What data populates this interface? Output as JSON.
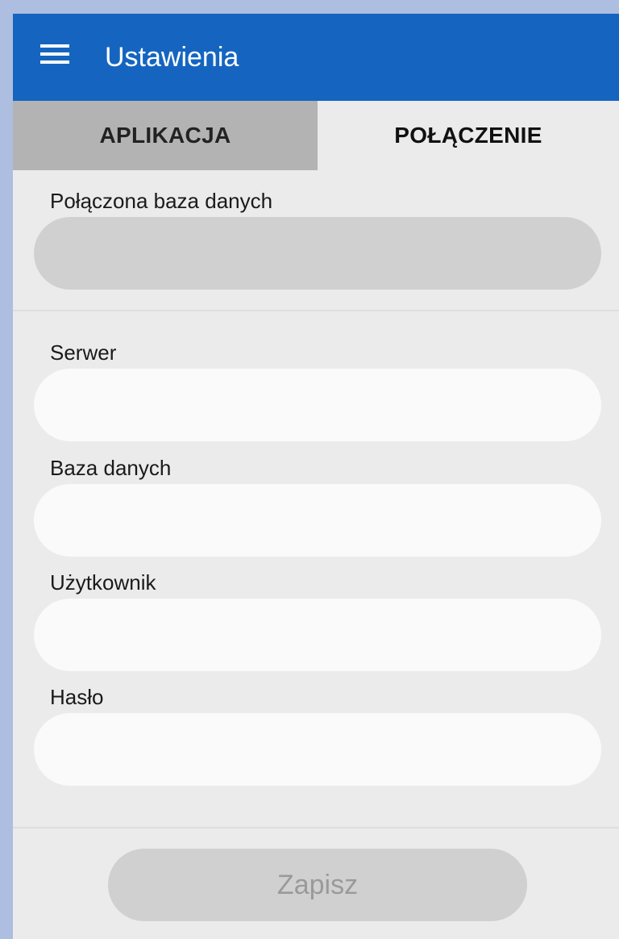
{
  "appbar": {
    "title": "Ustawienia",
    "menu_icon": "hamburger-menu-icon",
    "color": "#1565c0"
  },
  "tabs": [
    {
      "label": "APLIKACJA",
      "selected": false
    },
    {
      "label": "POŁĄCZENIE",
      "selected": true
    }
  ],
  "connected_db": {
    "label": "Połączona baza danych",
    "value": ""
  },
  "fields": {
    "server": {
      "label": "Serwer",
      "value": ""
    },
    "database": {
      "label": "Baza danych",
      "value": ""
    },
    "user": {
      "label": "Użytkownik",
      "value": ""
    },
    "password": {
      "label": "Hasło",
      "value": ""
    }
  },
  "save_button": {
    "label": "Zapisz",
    "enabled": false
  }
}
